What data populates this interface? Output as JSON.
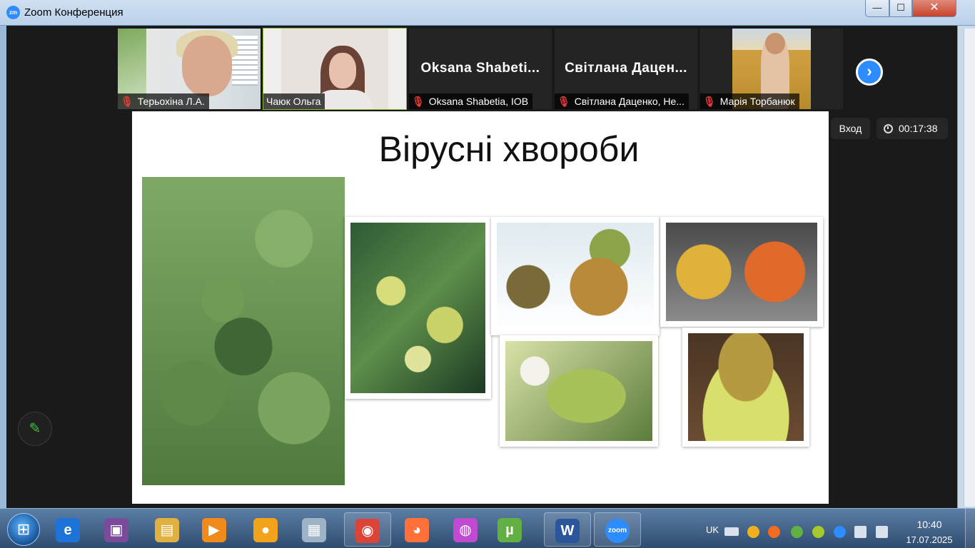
{
  "window": {
    "title": "Zoom Конференция",
    "logo_text": "zm",
    "buttons": {
      "minimize": "—",
      "maximize": "☐",
      "close": "✕"
    }
  },
  "gallery": {
    "participants": [
      {
        "name": "Терьохіна Л.А.",
        "muted": true,
        "video": true
      },
      {
        "name": "Чаюк Ольга",
        "muted": false,
        "video": true,
        "active_speaker": true
      },
      {
        "name": "Oksana Shabetia, IOB",
        "display_name": "Oksana  Shabeti...",
        "muted": true,
        "video": false
      },
      {
        "name": "Світлана Даценко, Не...",
        "display_name": "Світлана  Дацен...",
        "muted": true,
        "video": false
      },
      {
        "name": "Марія Торбанюк",
        "muted": true,
        "video": true
      }
    ],
    "mic_off_symbol": "🎙",
    "next_page_symbol": "›"
  },
  "controls": {
    "exit_label": "Вход",
    "timer": "00:17:38",
    "annotate_symbol": "✎"
  },
  "slide": {
    "title": "Вірусні хвороби"
  },
  "taskbar": {
    "apps": [
      {
        "name": "internet-explorer",
        "symbol": "e",
        "color": "#1e73d8"
      },
      {
        "name": "save-disk",
        "symbol": "▣",
        "color": "#7a4b9a"
      },
      {
        "name": "file-explorer",
        "symbol": "▤",
        "color": "#e0b040"
      },
      {
        "name": "media-player",
        "symbol": "▶",
        "color": "#f08a1a"
      },
      {
        "name": "vpn-lock",
        "symbol": "●",
        "color": "#f3a21c"
      },
      {
        "name": "calculator",
        "symbol": "▦",
        "color": "#9fb3c7"
      },
      {
        "name": "chrome",
        "symbol": "◉",
        "color": "#db4437"
      },
      {
        "name": "firefox",
        "symbol": "◕",
        "color": "#ff7139"
      },
      {
        "name": "color-app",
        "symbol": "◍",
        "color": "#c04bd0"
      },
      {
        "name": "utorrent",
        "symbol": "µ",
        "color": "#62b044"
      },
      {
        "name": "word",
        "symbol": "W",
        "color": "#2b579a"
      },
      {
        "name": "zoom",
        "symbol": "zoom",
        "color": "#2d8cff"
      }
    ],
    "tray": {
      "language": "UK",
      "time": "10:40",
      "date": "17.07.2025"
    }
  }
}
